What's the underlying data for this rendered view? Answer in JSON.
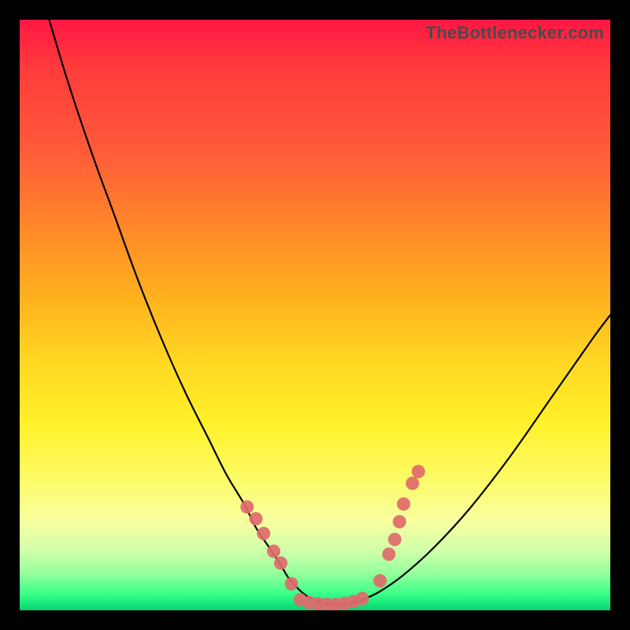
{
  "watermark": "TheBottlenecker.com",
  "colors": {
    "curve": "#000000",
    "marker_fill": "#e06a6c",
    "marker_stroke": "#c44e52"
  },
  "chart_data": {
    "type": "line",
    "title": "",
    "xlabel": "",
    "ylabel": "",
    "xlim": [
      0,
      100
    ],
    "ylim": [
      0,
      100
    ],
    "curve": {
      "x": [
        5,
        8,
        12,
        16,
        20,
        24,
        28,
        32,
        35,
        38,
        40,
        42,
        44,
        45.5,
        47,
        48.5,
        50,
        51.5,
        53,
        54.5,
        56,
        58,
        61,
        65,
        70,
        76,
        83,
        90,
        97,
        100
      ],
      "y": [
        100,
        90,
        78,
        67,
        56,
        46,
        37,
        29,
        23,
        18,
        14,
        11,
        8,
        5.5,
        3.8,
        2.5,
        1.7,
        1.2,
        1.0,
        1.0,
        1.2,
        1.8,
        3.2,
        6.0,
        10.5,
        17,
        26,
        36,
        46,
        50
      ]
    },
    "series": [
      {
        "name": "markers-left",
        "x": [
          38.5,
          40.0,
          41.3,
          43.0,
          44.2,
          46.0
        ],
        "y": [
          17.5,
          15.5,
          13.0,
          10.0,
          8.0,
          4.5
        ]
      },
      {
        "name": "markers-bottom",
        "x": [
          47.5,
          49.0,
          50.5,
          52.0,
          53.5,
          55.0,
          56.5,
          58.0
        ],
        "y": [
          1.8,
          1.3,
          1.1,
          1.0,
          1.0,
          1.2,
          1.5,
          2.0
        ]
      },
      {
        "name": "markers-right",
        "x": [
          61.0,
          62.5,
          63.5,
          64.3,
          65.0,
          66.5,
          67.5
        ],
        "y": [
          5.0,
          9.5,
          12.0,
          15.0,
          18.0,
          21.5,
          23.5
        ]
      }
    ]
  }
}
